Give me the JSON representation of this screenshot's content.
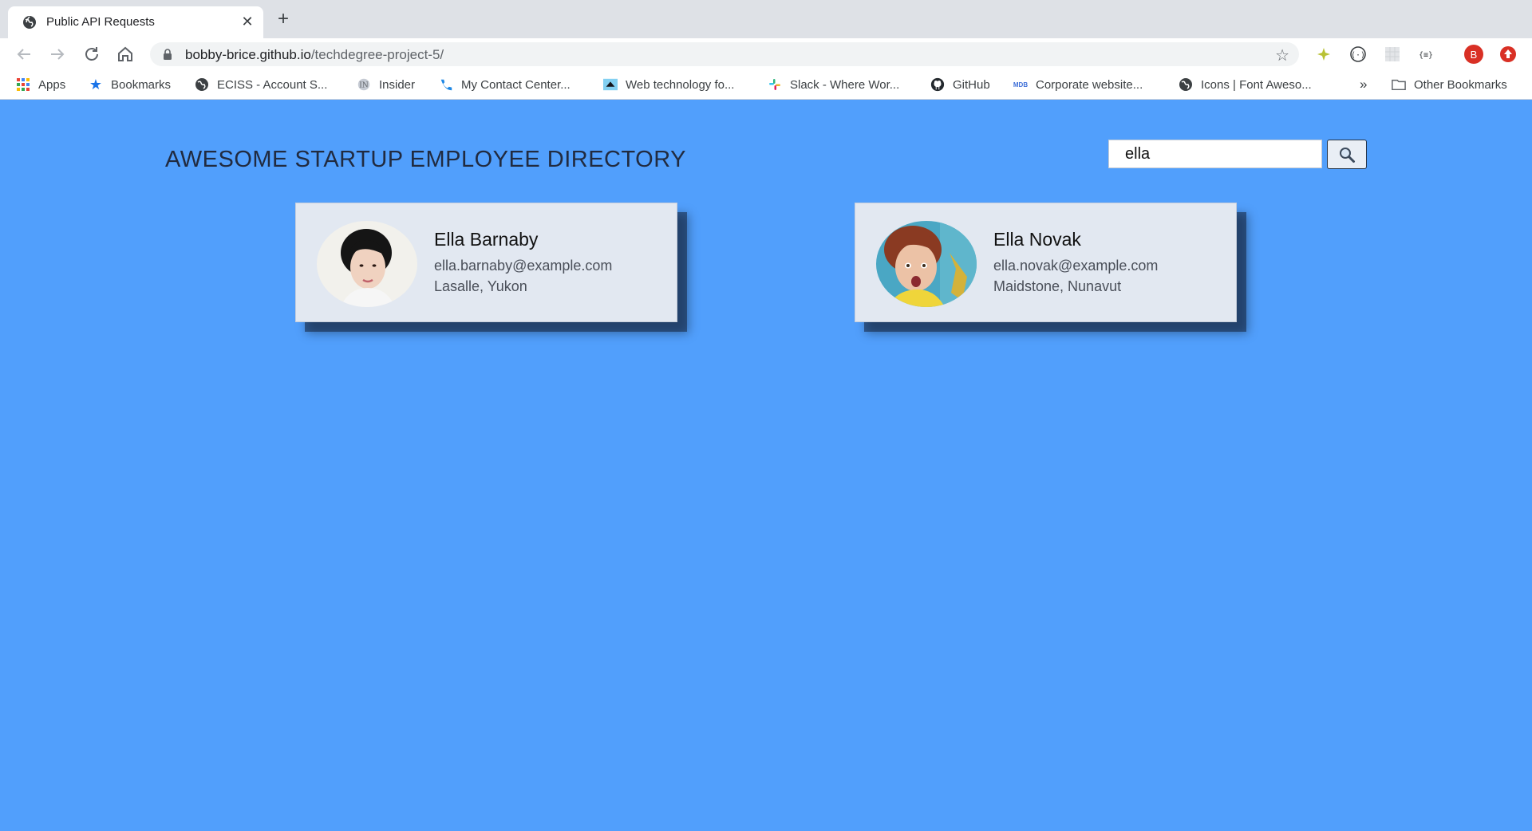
{
  "browser": {
    "tab_title": "Public API Requests",
    "tab_close": "✕",
    "new_tab": "+",
    "url_host": "bobby-brice.github.io",
    "url_path": "/techdegree-project-5/",
    "profile_initial": "B"
  },
  "bookmarks": [
    {
      "label": "Apps",
      "icon": "apps-grid-icon"
    },
    {
      "label": "Bookmarks",
      "icon": "star-icon"
    },
    {
      "label": "ECISS - Account S...",
      "icon": "globe-icon"
    },
    {
      "label": "Insider",
      "icon": "insider-icon"
    },
    {
      "label": "My Contact Center...",
      "icon": "phone-icon"
    },
    {
      "label": "Web technology fo...",
      "icon": "mdn-icon"
    },
    {
      "label": "Slack - Where Wor...",
      "icon": "slack-icon"
    },
    {
      "label": "GitHub",
      "icon": "github-icon"
    },
    {
      "label": "Corporate website...",
      "icon": "mdb-icon"
    },
    {
      "label": "Icons | Font Aweso...",
      "icon": "globe-icon"
    }
  ],
  "bookmarks_overflow": "»",
  "other_bookmarks": "Other Bookmarks",
  "page": {
    "title": "AWESOME STARTUP EMPLOYEE DIRECTORY",
    "search_value": "ella"
  },
  "employees": [
    {
      "name": "Ella Barnaby",
      "email": "ella.barnaby@example.com",
      "location": "Lasalle, Yukon"
    },
    {
      "name": "Ella Novak",
      "email": "ella.novak@example.com",
      "location": "Maidstone, Nunavut"
    }
  ],
  "colors": {
    "page_background": "#519ffc",
    "card_background": "#e2e8f1",
    "title_text": "#212b40"
  }
}
